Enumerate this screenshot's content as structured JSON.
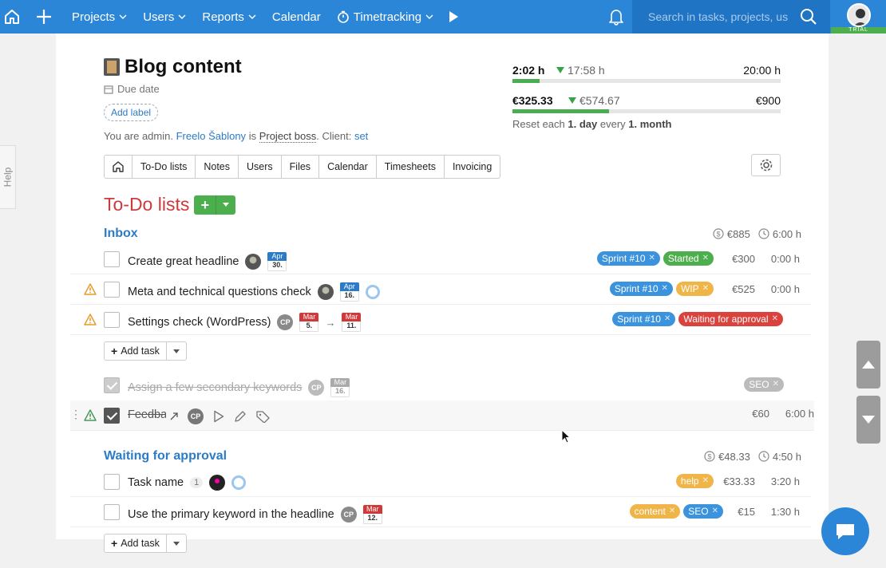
{
  "nav": {
    "items": [
      {
        "label": "Projects",
        "dropdown": true
      },
      {
        "label": "Users",
        "dropdown": true
      },
      {
        "label": "Reports",
        "dropdown": true
      },
      {
        "label": "Calendar",
        "dropdown": false
      },
      {
        "label": "Timetracking",
        "dropdown": true
      }
    ],
    "search_placeholder": "Search in tasks, projects, us",
    "trial_badge": "TRIAL"
  },
  "help_tab": "Help",
  "project": {
    "title": "Blog content",
    "due_date_label": "Due date",
    "add_label": "Add label",
    "admin_text": "You are admin.",
    "owner": "Freelo Šablony",
    "is_text": "is",
    "role": "Project boss",
    "client_text": ". Client:",
    "client_link": "set"
  },
  "stats": {
    "time_spent": "2:02 h",
    "time_remaining": "17:58 h",
    "time_budget": "20:00 h",
    "time_progress": 0.1,
    "money_spent": "€325.33",
    "money_remaining": "€574.67",
    "money_budget": "€900",
    "money_progress": 0.36,
    "reset_prefix": "Reset each",
    "reset_day": "1. day",
    "reset_every": "every",
    "reset_month": "1. month"
  },
  "tabs": [
    "To-Do lists",
    "Notes",
    "Users",
    "Files",
    "Calendar",
    "Timesheets",
    "Invoicing"
  ],
  "section_title": "To-Do lists",
  "add_task_label": "Add task",
  "lists": [
    {
      "name": "Inbox",
      "sum_price": "€885",
      "sum_time": "6:00 h",
      "tasks": [
        {
          "name": "Create great headline",
          "date_month": "Apr",
          "date_day": "30.",
          "tags": [
            {
              "label": "Sprint #10",
              "color": "#3a93dc"
            },
            {
              "label": "Started",
              "color": "#4cae4c"
            }
          ],
          "price": "€300",
          "time": "0:00 h"
        },
        {
          "name": "Meta and technical questions check",
          "date_month": "Apr",
          "date_day": "16.",
          "tags": [
            {
              "label": "Sprint #10",
              "color": "#3a93dc"
            },
            {
              "label": "WIP",
              "color": "#f0b549"
            }
          ],
          "price": "€525",
          "time": "0:00 h"
        },
        {
          "name": "Settings check (WordPress)",
          "assignee": "CP",
          "date_from_month": "Mar",
          "date_from_day": "5.",
          "date_to_month": "Mar",
          "date_to_day": "11.",
          "tags": [
            {
              "label": "Sprint #10",
              "color": "#3a93dc"
            },
            {
              "label": "Waiting for approval",
              "color": "#d9423d"
            }
          ]
        }
      ],
      "done_tasks": [
        {
          "name": "Assign a few secondary keywords",
          "assignee": "CP",
          "date_month": "Mar",
          "date_day": "16.",
          "tags": [
            {
              "label": "SEO",
              "color": "#bbbbbb"
            }
          ]
        },
        {
          "name": "Feedback",
          "assignee": "CP",
          "price": "€60",
          "time": "6:00 h"
        }
      ]
    },
    {
      "name": "Waiting for approval",
      "sum_price": "€48.33",
      "sum_time": "4:50 h",
      "tasks": [
        {
          "name": "Task name",
          "count": "1",
          "tags": [
            {
              "label": "help",
              "color": "#f0b549"
            }
          ],
          "price": "€33.33",
          "time": "3:20 h"
        },
        {
          "name": "Use the primary keyword in the headline",
          "assignee": "CP",
          "date_month": "Mar",
          "date_day": "12.",
          "tags": [
            {
              "label": "content",
              "color": "#f0b549"
            },
            {
              "label": "SEO",
              "color": "#3a93dc"
            }
          ],
          "price": "€15",
          "time": "1:30 h"
        }
      ]
    }
  ]
}
